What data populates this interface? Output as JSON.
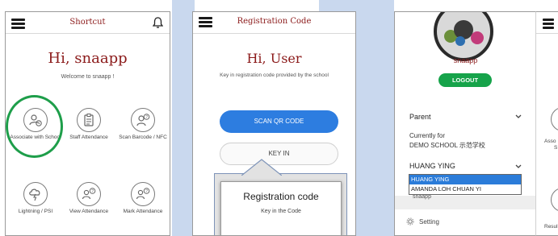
{
  "colors": {
    "accent_red": "#8b1a1a",
    "brand_blue": "#2d7de0",
    "logout_green": "#16a34a",
    "highlight": "#2b7cd9"
  },
  "screen1": {
    "title": "Shortcut",
    "greeting": "Hi, snaapp",
    "welcome": "Welcome to snaapp !",
    "tiles": [
      {
        "label": "Associate with School",
        "icon": "person-clock-icon"
      },
      {
        "label": "Staff Attendance",
        "icon": "clipboard-icon"
      },
      {
        "label": "Scan Barcode / NFC",
        "icon": "person-question-icon"
      },
      {
        "label": "Lightning / PSI",
        "icon": "cloud-lightning-icon"
      },
      {
        "label": "View Attendance",
        "icon": "people-question-icon"
      },
      {
        "label": "Mark Attendance",
        "icon": "people-question-icon"
      }
    ]
  },
  "screen2": {
    "title": "Registration Code",
    "greeting": "Hi, User",
    "instruction": "Key in registration code provided by the school",
    "scan_button": "SCAN QR CODE",
    "keyin_button": "KEY IN",
    "modal_title": "Registration code",
    "modal_subtitle": "Key in the Code"
  },
  "screen3": {
    "username": "snaapp",
    "logout": "LOGOUT",
    "role": "Parent",
    "currently_for_label": "Currently for",
    "school": "DEMO SCHOOL 示范学校",
    "selected_child": "HUANG YING",
    "dropdown_options": [
      "HUANG YING",
      "AMANDA LOH CHUAN YI"
    ],
    "partial_item": "snaapp",
    "setting": "Setting"
  },
  "screen4": {
    "partial_tile_1": "Asso",
    "partial_tile_1b": "S",
    "partial_tile_2": "Resul"
  }
}
